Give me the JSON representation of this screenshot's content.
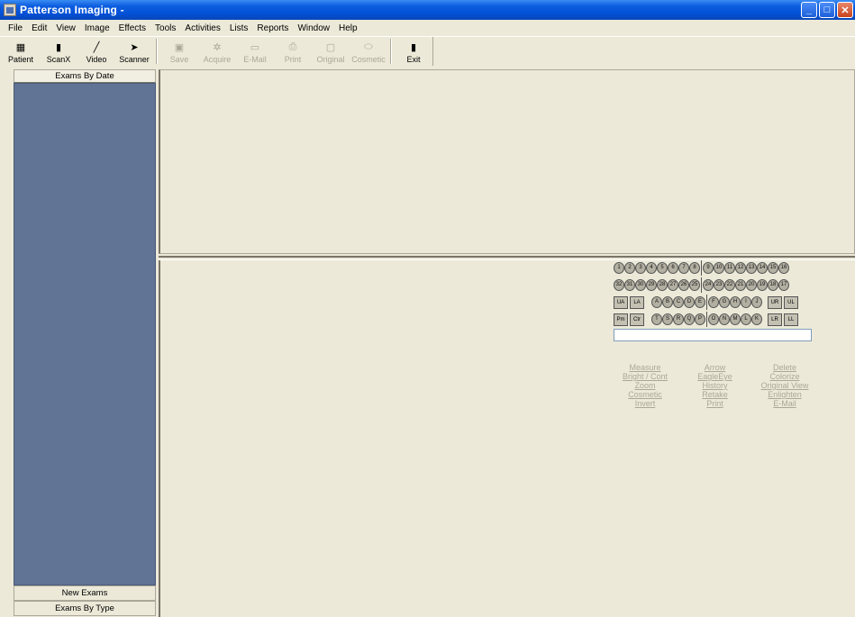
{
  "window": {
    "title": "Patterson Imaging -"
  },
  "menu": [
    "File",
    "Edit",
    "View",
    "Image",
    "Effects",
    "Tools",
    "Activities",
    "Lists",
    "Reports",
    "Window",
    "Help"
  ],
  "toolbar": {
    "group1": [
      {
        "label": "Patient",
        "icon": "patient-icon"
      },
      {
        "label": "ScanX",
        "icon": "scanx-icon"
      },
      {
        "label": "Video",
        "icon": "video-icon"
      },
      {
        "label": "Scanner",
        "icon": "scanner-icon"
      }
    ],
    "group2": [
      {
        "label": "Save",
        "icon": "save-icon"
      },
      {
        "label": "Acquire",
        "icon": "acquire-icon"
      },
      {
        "label": "E-Mail",
        "icon": "email-icon"
      },
      {
        "label": "Print",
        "icon": "print-icon"
      },
      {
        "label": "Original",
        "icon": "original-icon"
      },
      {
        "label": "Cosmetic",
        "icon": "cosmetic-icon"
      }
    ],
    "exit": {
      "label": "Exit",
      "icon": "exit-icon"
    }
  },
  "left_panel": {
    "top_header": "Exams By Date",
    "new_exams": "New Exams",
    "by_type": "Exams By Type"
  },
  "tooth_chart": {
    "upper_row": [
      "1",
      "2",
      "3",
      "4",
      "5",
      "6",
      "7",
      "8",
      "9",
      "10",
      "11",
      "12",
      "13",
      "14",
      "15",
      "16"
    ],
    "lower_row": [
      "32",
      "31",
      "30",
      "29",
      "28",
      "27",
      "26",
      "25",
      "24",
      "23",
      "22",
      "21",
      "20",
      "19",
      "18",
      "17"
    ],
    "upper_arch_left": [
      "UA",
      "LA"
    ],
    "upper_primary": [
      "A",
      "B",
      "C",
      "D",
      "E",
      "F",
      "G",
      "H",
      "I",
      "J"
    ],
    "upper_arch_right": [
      "UR",
      "UL"
    ],
    "lower_arch_left": [
      "Pm",
      "Ctr"
    ],
    "lower_primary": [
      "T",
      "S",
      "R",
      "Q",
      "P",
      "O",
      "N",
      "M",
      "L",
      "K"
    ],
    "lower_arch_right": [
      "LR",
      "LL"
    ]
  },
  "tool_links": {
    "col1": [
      "Measure",
      "Bright / Cont",
      "Zoom",
      "Cosmetic",
      "Invert"
    ],
    "col2": [
      "Arrow",
      "EagleEye",
      "History",
      "Retake",
      "Print"
    ],
    "col3": [
      "Delete",
      "Colorize",
      "Original View",
      "Enlighten",
      "E-Mail"
    ]
  },
  "colors": {
    "exam_list_bg": "#627495",
    "titlebar": "#0a5bd9"
  }
}
